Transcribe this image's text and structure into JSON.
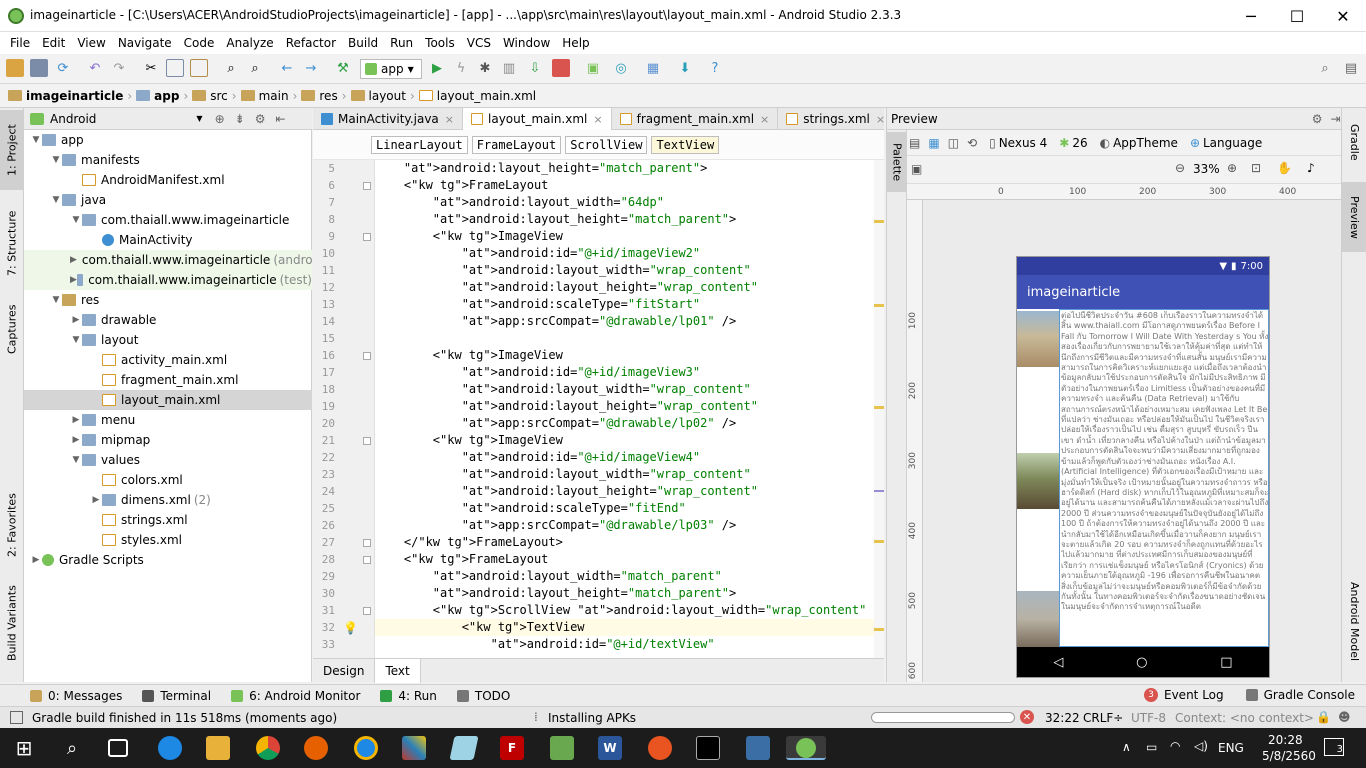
{
  "window": {
    "title": "imageinarticle - [C:\\Users\\ACER\\AndroidStudioProjects\\imageinarticle] - [app] - ...\\app\\src\\main\\res\\layout\\layout_main.xml - Android Studio 2.3.3",
    "minimize": "─",
    "maximize": "☐",
    "close": "✕"
  },
  "menu": [
    "File",
    "Edit",
    "View",
    "Navigate",
    "Code",
    "Analyze",
    "Refactor",
    "Build",
    "Run",
    "Tools",
    "VCS",
    "Window",
    "Help"
  ],
  "toolbar": {
    "run_config": "app"
  },
  "breadcrumb": [
    "imageinarticle",
    "app",
    "src",
    "main",
    "res",
    "layout",
    "layout_main.xml"
  ],
  "left_tabs": {
    "project": "1: Project",
    "structure": "7: Structure",
    "captures": "Captures",
    "favorites": "2: Favorites",
    "build_variants": "Build Variants"
  },
  "right_tabs": {
    "gradle": "Gradle",
    "preview": "Preview",
    "android_model": "Android Model"
  },
  "project": {
    "view": "Android",
    "tree": [
      {
        "label": "app",
        "level": 0,
        "arrow": "▼",
        "icon": "folder"
      },
      {
        "label": "manifests",
        "level": 1,
        "arrow": "▼",
        "icon": "folder"
      },
      {
        "label": "AndroidManifest.xml",
        "level": 2,
        "arrow": "",
        "icon": "xml"
      },
      {
        "label": "java",
        "level": 1,
        "arrow": "▼",
        "icon": "folder"
      },
      {
        "label": "com.thaiall.www.imageinarticle",
        "level": 2,
        "arrow": "▼",
        "icon": "folder"
      },
      {
        "label": "MainActivity",
        "level": 3,
        "arrow": "",
        "icon": "cls"
      },
      {
        "label": "com.thaiall.www.imageinarticle",
        "suffix": "(androi",
        "level": 2,
        "arrow": "▶",
        "icon": "folder",
        "hl": true
      },
      {
        "label": "com.thaiall.www.imageinarticle",
        "suffix": "(test)",
        "level": 2,
        "arrow": "▶",
        "icon": "folder",
        "hl": true
      },
      {
        "label": "res",
        "level": 1,
        "arrow": "▼",
        "icon": "folderres"
      },
      {
        "label": "drawable",
        "level": 2,
        "arrow": "▶",
        "icon": "folder"
      },
      {
        "label": "layout",
        "level": 2,
        "arrow": "▼",
        "icon": "folder"
      },
      {
        "label": "activity_main.xml",
        "level": 3,
        "arrow": "",
        "icon": "xml"
      },
      {
        "label": "fragment_main.xml",
        "level": 3,
        "arrow": "",
        "icon": "xml"
      },
      {
        "label": "layout_main.xml",
        "level": 3,
        "arrow": "",
        "icon": "xml",
        "sel": true
      },
      {
        "label": "menu",
        "level": 2,
        "arrow": "▶",
        "icon": "folder"
      },
      {
        "label": "mipmap",
        "level": 2,
        "arrow": "▶",
        "icon": "folder"
      },
      {
        "label": "values",
        "level": 2,
        "arrow": "▼",
        "icon": "folder"
      },
      {
        "label": "colors.xml",
        "level": 3,
        "arrow": "",
        "icon": "xml"
      },
      {
        "label": "dimens.xml",
        "suffix": "(2)",
        "level": 3,
        "arrow": "▶",
        "icon": "folder"
      },
      {
        "label": "strings.xml",
        "level": 3,
        "arrow": "",
        "icon": "xml"
      },
      {
        "label": "styles.xml",
        "level": 3,
        "arrow": "",
        "icon": "xml"
      },
      {
        "label": "Gradle Scripts",
        "level": 0,
        "arrow": "▶",
        "icon": "grad"
      }
    ]
  },
  "editor": {
    "tabs": [
      {
        "label": "MainActivity.java",
        "active": false
      },
      {
        "label": "layout_main.xml",
        "active": true
      },
      {
        "label": "fragment_main.xml",
        "active": false
      },
      {
        "label": "strings.xml",
        "active": false
      }
    ],
    "overflow": "≡",
    "tags": [
      "LinearLayout",
      "FrameLayout",
      "ScrollView",
      "TextView"
    ],
    "lines": [
      {
        "n": "5",
        "t": "    android:layout_height=\"match_parent\">"
      },
      {
        "n": "6",
        "t": "    <FrameLayout"
      },
      {
        "n": "7",
        "t": "        android:layout_width=\"64dp\""
      },
      {
        "n": "8",
        "t": "        android:layout_height=\"match_parent\">"
      },
      {
        "n": "9",
        "t": "        <ImageView"
      },
      {
        "n": "10",
        "t": "            android:id=\"@+id/imageView2\""
      },
      {
        "n": "11",
        "t": "            android:layout_width=\"wrap_content\""
      },
      {
        "n": "12",
        "t": "            android:layout_height=\"wrap_content\""
      },
      {
        "n": "13",
        "t": "            android:scaleType=\"fitStart\""
      },
      {
        "n": "14",
        "t": "            app:srcCompat=\"@drawable/lp01\" />"
      },
      {
        "n": "15",
        "t": ""
      },
      {
        "n": "16",
        "t": "        <ImageView"
      },
      {
        "n": "17",
        "t": "            android:id=\"@+id/imageView3\""
      },
      {
        "n": "18",
        "t": "            android:layout_width=\"wrap_content\""
      },
      {
        "n": "19",
        "t": "            android:layout_height=\"wrap_content\""
      },
      {
        "n": "20",
        "t": "            app:srcCompat=\"@drawable/lp02\" />"
      },
      {
        "n": "21",
        "t": "        <ImageView"
      },
      {
        "n": "22",
        "t": "            android:id=\"@+id/imageView4\""
      },
      {
        "n": "23",
        "t": "            android:layout_width=\"wrap_content\""
      },
      {
        "n": "24",
        "t": "            android:layout_height=\"wrap_content\""
      },
      {
        "n": "25",
        "t": "            android:scaleType=\"fitEnd\""
      },
      {
        "n": "26",
        "t": "            app:srcCompat=\"@drawable/lp03\" />"
      },
      {
        "n": "27",
        "t": "    </FrameLayout>"
      },
      {
        "n": "28",
        "t": "    <FrameLayout"
      },
      {
        "n": "29",
        "t": "        android:layout_width=\"match_parent\""
      },
      {
        "n": "30",
        "t": "        android:layout_height=\"match_parent\">"
      },
      {
        "n": "31",
        "t": "        <ScrollView android:layout_width=\"wrap_content\" android:layout_he"
      },
      {
        "n": "32",
        "t": "            <TextView"
      },
      {
        "n": "33",
        "t": "                android:id=\"@+id/textView\""
      }
    ],
    "bottom_tabs": [
      "Design",
      "Text"
    ]
  },
  "preview": {
    "title": "Preview",
    "device": "Nexus 4",
    "api": "26",
    "theme": "AppTheme",
    "language": "Language",
    "zoom": "33%",
    "ruler_x": [
      "0",
      "100",
      "200",
      "300",
      "400"
    ],
    "ruler_y": [
      "100",
      "200",
      "300",
      "400",
      "500",
      "600"
    ],
    "phone": {
      "time": "7:00",
      "app_title": "imageinarticle",
      "text": "ต่อไปนี้ชีวิตประจำวัน #608 เก็บเรื่องราวในความทรงจำได้สิ้น www.thaiall.com มีโอกาสดูภาพยนตร์เรื่อง Before I Fall กับ Tomorrow I Will Date With Yesterday s You ทั้งสองเรื่องเกี่ยวกับการพยายามใช้เวลาให้คุ้มค่าที่สุด แต่ทำให้นึกถึงการมีชีวิตและมีความทรงจำที่แสนสั้น มนุษย์เรามีความสามารถในการคิดวิเคราะห์แยกแยะสูง แต่เมื่อถึงเวลาต้องนำข้อมูลกลับมาใช้ประกอบการตัดสินใจ มักไม่มีประสิทธิภาพ มีตัวอย่างในภาพยนตร์เรื่อง Limitless เป็นตัวอย่างของคนที่มีความทรงจำ และค้นคืน (Data Retrieval) มาใช้กับสถานการณ์ตรงหน้าได้อย่างเหมาะสม เคยฟังเพลง Let It Be ที่แปลว่า ช่างมันเถอะ หรือปล่อยให้มันเป็นไป ในชีวิตจริงเราปล่อยให้เรื่องราวเป็นไป เช่น ดื่มสุรา สูบบุหรี่ ขับรถเร็ว ปีนเขา ดำน้ำ เที่ยวกลางคืน หรือไปค้างในป่า แต่ถ้านำข้อมูลมาประกอบการตัดสินใจจะพบว่ามีความเสี่ยงมากมายที่ถูกมองข้ามแล้วก็พูดกับตัวเองว่าช่างมันเถอะ หนังเรื่อง A.I. (Artificial Intelligence) ที่ตัวเอกของเรื่องมีเป้าหมาย และมุ่งมั่นทำให้เป็นจริง เป้าหมายนั้นอยู่ในความทรงจำถาวร หรือฮาร์ดดิสก์ (Hard disk) หากเก็บไว้ในอุณหภูมิที่เหมาะสมก็จะอยู่ได้นาน และสามารถค้นคืนได้ภายหลังแม้เวลาจะผ่านไปถึง 2000 ปี ส่วนความทรงจำของมนุษย์ในปัจจุบันยังอยู่ได้ไม่ถึง 100 ปี ถ้าต้องการให้ความทรงจำอยู่ได้นานถึง 2000 ปี และนำกลับมาใช้ได้อีกเหมือนเกิดขึ้นเมื่อวานก็คงยาก มนุษย์เราจะตายแล้วเกิด 20 รอบ ความทรงจำก็คงถูกแทนที่ด้วยอะไรไปแล้วมากมาย ที่ต่างประเทศมีการเก็บสมองของมนุษย์ที่เรียกว่า การแช่แข็งมนุษย์ หรือไครโอนิกส์ (Cryonics) ด้วยความเย็นภายใต้อุณหภูมิ -196 เพื่อรอการคืนชีพในอนาคต สิ่งเก็บข้อมูลไม่ว่าจะมนุษย์หรือคอมพิวเตอร์ก็มีข้อจำกัดด้วยกันทั้งนั้น ในทางคอมพิวเตอร์จะจำกัดเรื่องขนาดอย่างชัดเจน ในมนุษย์จะจำกัดการจำเหตุการณ์ในอดีต",
      "nav": [
        "◁",
        "○",
        "□"
      ]
    }
  },
  "bottom_tools": [
    {
      "label": "0: Messages",
      "color": "#c8a45a"
    },
    {
      "label": "Terminal",
      "color": "#555555"
    },
    {
      "label": "6: Android Monitor",
      "color": "#78c257"
    },
    {
      "label": "4: Run",
      "color": "#2ea043"
    },
    {
      "label": "TODO",
      "color": "#777777"
    }
  ],
  "bottom_right_tools": {
    "event_log": "Event Log",
    "event_count": "3",
    "gradle_console": "Gradle Console"
  },
  "status": {
    "message": "Gradle build finished in 11s 518ms (moments ago)",
    "progress": "Installing APKs",
    "position": "32:22",
    "line_sep": "CRLF÷",
    "encoding": "UTF-8",
    "context": "Context: <no context>"
  },
  "taskbar": {
    "lang": "ENG",
    "time": "20:28",
    "date": "5/8/2560",
    "notifications": "3"
  },
  "colors": {
    "accent": "#3f51b5",
    "accent_dark": "#303f9f",
    "selection": "#d5d5d5"
  }
}
